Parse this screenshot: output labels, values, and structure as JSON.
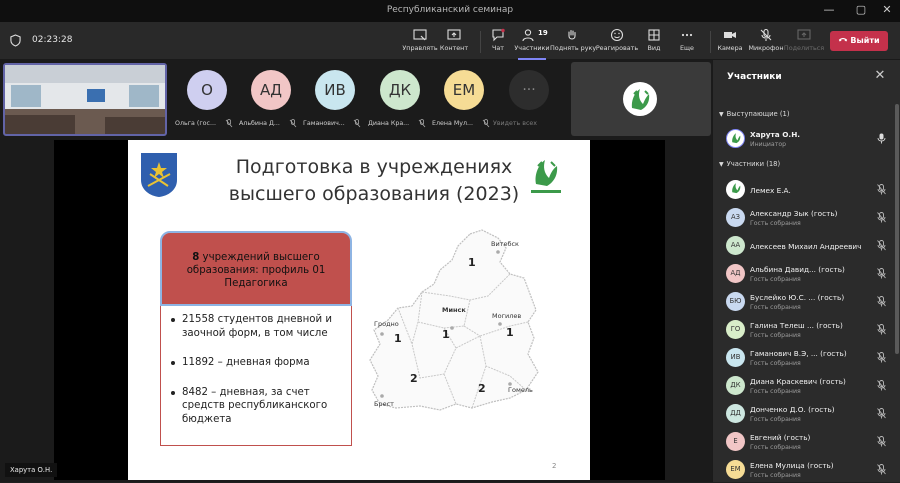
{
  "window": {
    "title": "Республиканский семинар"
  },
  "meeting": {
    "timer": "02:23:28",
    "toolbar": {
      "manage": "Управлять",
      "content": "Контент",
      "chat": "Чат",
      "participants": "Участники",
      "participants_count": "19",
      "raise_hand": "Поднять руку",
      "react": "Реагировать",
      "view": "Вид",
      "more": "Еще",
      "camera": "Камера",
      "mic": "Микрофон",
      "share": "Поделиться",
      "leave": "Выйти"
    }
  },
  "gallery": {
    "tiles": [
      {
        "initials": "О",
        "name": "Ольга (гос...",
        "color": "#cfcff0"
      },
      {
        "initials": "АД",
        "name": "Альбина Д...",
        "color": "#f1c6c6"
      },
      {
        "initials": "ИВ",
        "name": "Гаманович...",
        "color": "#c9e6ef"
      },
      {
        "initials": "ДК",
        "name": "Диана Кра...",
        "color": "#cde7cd"
      },
      {
        "initials": "ЕМ",
        "name": "Елена Мул...",
        "color": "#f6dc95"
      }
    ],
    "see_all": "Увидеть всех"
  },
  "slide": {
    "title": "Подготовка в учреждениях\nвысшего образования (2023)",
    "box": {
      "count": "8",
      "head_rest": " учреждений высшего образования: профиль 01 Педагогика"
    },
    "bullets": [
      "21558 студентов дневной и заочной форм, в том числе",
      "11892 –  дневная форма",
      "8482 – дневная, за счет средств республиканского бюджета"
    ],
    "map": {
      "regions": [
        {
          "name": "Витебск",
          "count": "1"
        },
        {
          "name": "Гродно",
          "count": "1"
        },
        {
          "name": "Минск",
          "count": "1"
        },
        {
          "name": "Могилев",
          "count": "1"
        },
        {
          "name": "Брест",
          "count": "2"
        },
        {
          "name": "Гомель",
          "count": "2"
        }
      ]
    },
    "page": "2"
  },
  "speaker_tag": "Харута О.Н.",
  "participants_panel": {
    "title": "Участники",
    "presenters_header": "Выступающие (1)",
    "presenter": {
      "name": "Харута О.Н.",
      "role": "Инициатор"
    },
    "attendees_header": "Участники (18)",
    "attendees": [
      {
        "initials": "",
        "name": "Лемех Е.А.",
        "role": "",
        "color": "#ffffff"
      },
      {
        "initials": "АЗ",
        "name": "Александр Зык (гость)",
        "role": "Гость собрания",
        "color": "#c9d9f0"
      },
      {
        "initials": "АА",
        "name": "Алексеев Михаил Андреевич",
        "role": "",
        "color": "#cde7cd"
      },
      {
        "initials": "АД",
        "name": "Альбина Давид...  (гость)",
        "role": "Гость собрания",
        "color": "#f1c6c6"
      },
      {
        "initials": "БЮ",
        "name": "Буслейко Ю.С. ...  (гость)",
        "role": "Гость собрания",
        "color": "#c9d9f0"
      },
      {
        "initials": "ГО",
        "name": "Галина Телеш ...   (гость)",
        "role": "Гость собрания",
        "color": "#d9eec9"
      },
      {
        "initials": "ИВ",
        "name": "Гаманович В.Э, ...  (гость)",
        "role": "Гость собрания",
        "color": "#c9e6ef"
      },
      {
        "initials": "ДК",
        "name": "Диана Краскевич (гость)",
        "role": "Гость собрания",
        "color": "#cde7cd"
      },
      {
        "initials": "ДД",
        "name": "Донченко Д.О. (гость)",
        "role": "Гость собрания",
        "color": "#cde7e0"
      },
      {
        "initials": "Е",
        "name": "Евгений (гость)",
        "role": "Гость собрания",
        "color": "#f1c6c6"
      },
      {
        "initials": "ЕМ",
        "name": "Елена Мулица (гость)",
        "role": "Гость собрания",
        "color": "#f6dc95"
      }
    ]
  },
  "colors": {
    "accent": "#6264a7",
    "leave": "#c4314b",
    "slide_box": "#c0504d",
    "box_border": "#8eb4e3"
  }
}
